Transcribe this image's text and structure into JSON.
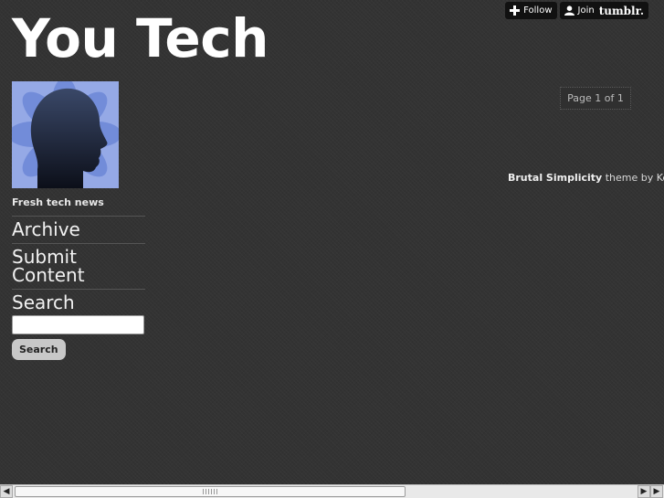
{
  "header": {
    "title": "You Tech"
  },
  "tumblr_controls": {
    "follow_label": "Follow",
    "join_label": "Join",
    "brand": "tumblr."
  },
  "sidebar": {
    "description": "Fresh tech news",
    "nav": [
      {
        "label": "Archive"
      },
      {
        "label": "Submit Content"
      }
    ],
    "search": {
      "heading": "Search",
      "input_value": "",
      "button_label": "Search"
    }
  },
  "main": {
    "pagination": "Page 1 of 1",
    "credits": {
      "theme_name": "Brutal Simplicity",
      "rest": " theme by Kevi"
    }
  },
  "colors": {
    "background": "#333333",
    "avatar_bg": "#95a9e6",
    "avatar_petals": "#6f89d8",
    "silhouette": "#1b2236"
  },
  "icons": [
    "plus-icon",
    "person-icon",
    "arrow-left-icon",
    "arrow-right-icon"
  ]
}
